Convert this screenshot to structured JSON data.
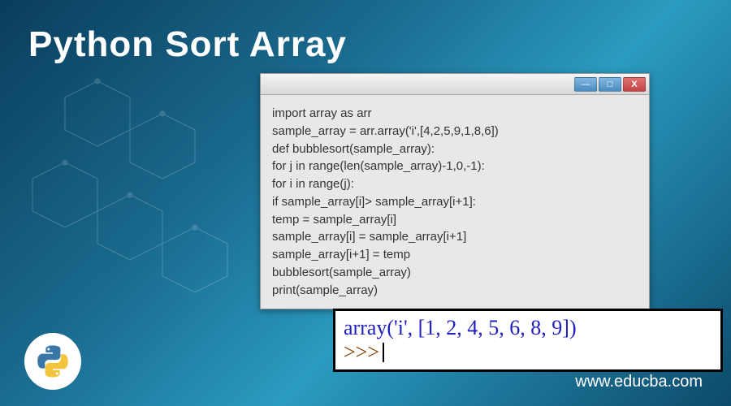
{
  "title": "Python Sort Array",
  "code_window": {
    "titlebar": {
      "minimize": "—",
      "maximize": "□",
      "close": "X"
    },
    "lines": [
      "import array as arr",
      "sample_array = arr.array('i',[4,2,5,9,1,8,6])",
      "def bubblesort(sample_array):",
      "for j in range(len(sample_array)-1,0,-1):",
      "for i in range(j):",
      "if sample_array[i]> sample_array[i+1]:",
      "temp = sample_array[i]",
      "sample_array[i] = sample_array[i+1]",
      "sample_array[i+1] = temp",
      "bubblesort(sample_array)",
      "print(sample_array)"
    ]
  },
  "output": {
    "result": "array('i', [1, 2, 4, 5, 6, 8, 9])",
    "prompt": ">>>"
  },
  "footer": {
    "url": "www.educba.com",
    "logo_name": "python-logo"
  },
  "chart_data": {
    "type": "table",
    "title": "Python Sort Array code sample and output",
    "input_array": [
      4,
      2,
      5,
      9,
      1,
      8,
      6
    ],
    "output_array": [
      1,
      2,
      4,
      5,
      6,
      8,
      9
    ],
    "array_typecode": "i",
    "algorithm": "bubblesort"
  }
}
